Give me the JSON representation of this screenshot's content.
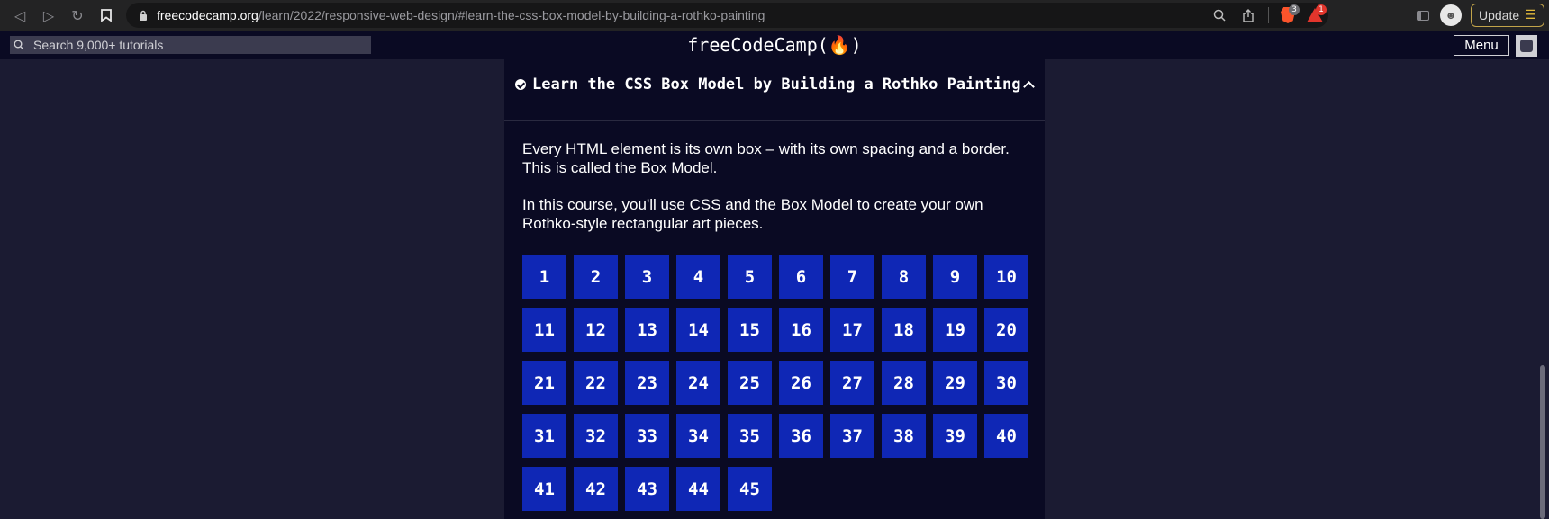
{
  "browser": {
    "url_host": "freecodecamp.org",
    "url_path": "/learn/2022/responsive-web-design/#learn-the-css-box-model-by-building-a-rothko-painting",
    "brave_shields_count": "3",
    "brave_rewards_count": "1",
    "update_label": "Update"
  },
  "nav": {
    "search_placeholder": "Search 9,000+ tutorials",
    "logo": "freeCodeCamp(🔥)",
    "menu_label": "Menu"
  },
  "block": {
    "title": "Learn the CSS Box Model by Building a Rothko Painting",
    "description_1": "Every HTML element is its own box – with its own spacing and a border. This is called the Box Model.",
    "description_2": "In this course, you'll use CSS and the Box Model to create your own Rothko-style rectangular art pieces.",
    "steps": [
      "1",
      "2",
      "3",
      "4",
      "5",
      "6",
      "7",
      "8",
      "9",
      "10",
      "11",
      "12",
      "13",
      "14",
      "15",
      "16",
      "17",
      "18",
      "19",
      "20",
      "21",
      "22",
      "23",
      "24",
      "25",
      "26",
      "27",
      "28",
      "29",
      "30",
      "31",
      "32",
      "33",
      "34",
      "35",
      "36",
      "37",
      "38",
      "39",
      "40",
      "41",
      "42",
      "43",
      "44",
      "45"
    ]
  },
  "colors": {
    "page_bg": "#1b1b32",
    "panel_bg": "#0a0a23",
    "step_bg": "#0f27b5",
    "update_accent": "#e1b93a"
  }
}
